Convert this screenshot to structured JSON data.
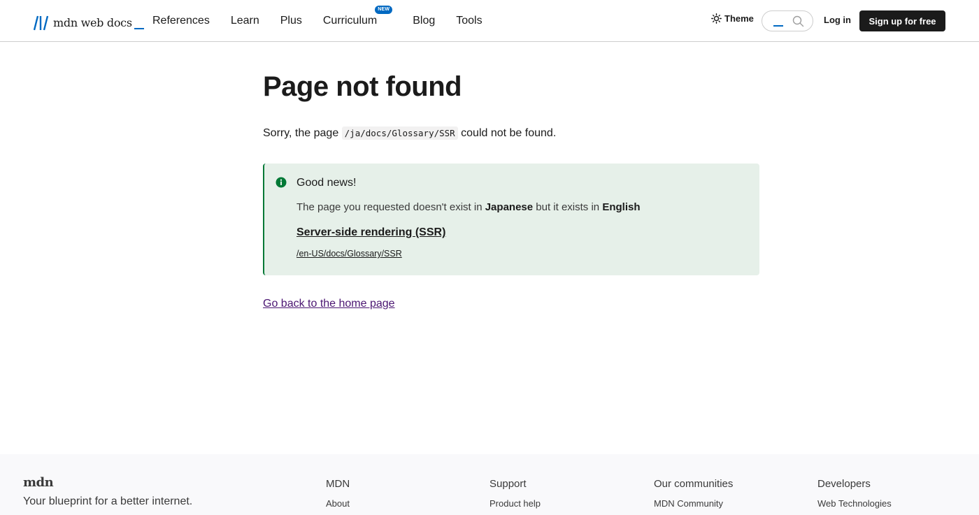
{
  "header": {
    "logo_text": "mdn web docs",
    "nav": [
      {
        "label": "References"
      },
      {
        "label": "Learn"
      },
      {
        "label": "Plus"
      },
      {
        "label": "Curriculum",
        "badge": "NEW"
      },
      {
        "label": "Blog"
      },
      {
        "label": "Tools"
      }
    ],
    "theme_label": "Theme",
    "login_label": "Log in",
    "signup_label": "Sign up for free"
  },
  "main": {
    "title": "Page not found",
    "sorry_prefix": "Sorry, the page ",
    "missing_path": "/ja/docs/Glossary/SSR",
    "sorry_suffix": " could not be found.",
    "notice": {
      "heading": "Good news!",
      "text_prefix": "The page you requested doesn't exist in ",
      "language_from": "Japanese",
      "text_middle": " but it exists in ",
      "language_to": "English",
      "link_title": "Server-side rendering (SSR)",
      "link_path": "/en-US/docs/Glossary/SSR"
    },
    "home_link": "Go back to the home page"
  },
  "footer": {
    "logo": "mdn",
    "tagline": "Your blueprint for a better internet.",
    "columns": [
      {
        "heading": "MDN",
        "first_link": "About"
      },
      {
        "heading": "Support",
        "first_link": "Product help"
      },
      {
        "heading": "Our communities",
        "first_link": "MDN Community"
      },
      {
        "heading": "Developers",
        "first_link": "Web Technologies"
      }
    ]
  },
  "colors": {
    "accent": "#0069c2",
    "notice_bg": "#e6f0e9",
    "notice_border": "#007936",
    "visited_link": "#4b1672"
  }
}
